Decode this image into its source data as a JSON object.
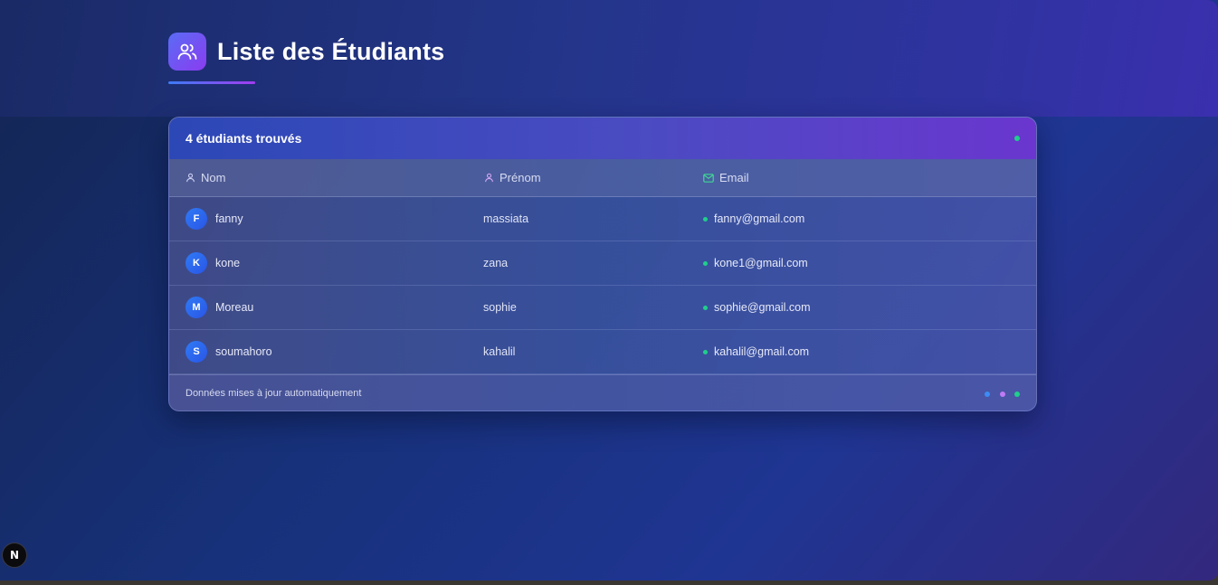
{
  "page": {
    "title": "Liste des Étudiants",
    "title_icon": "users-icon"
  },
  "table": {
    "count_label": "4 étudiants trouvés",
    "columns": [
      {
        "label": "Nom",
        "icon": "user-icon"
      },
      {
        "label": "Prénom",
        "icon": "user-icon"
      },
      {
        "label": "Email",
        "icon": "mail-icon"
      }
    ],
    "rows": [
      {
        "initial": "F",
        "nom": "fanny",
        "prenom": "massiata",
        "email": "fanny@gmail.com"
      },
      {
        "initial": "K",
        "nom": "kone",
        "prenom": "zana",
        "email": "kone1@gmail.com"
      },
      {
        "initial": "M",
        "nom": "Moreau",
        "prenom": "sophie",
        "email": "sophie@gmail.com"
      },
      {
        "initial": "S",
        "nom": "soumahoro",
        "prenom": "kahalil",
        "email": "kahalil@gmail.com"
      }
    ],
    "footer_note": "Données mises à jour automatiquement"
  },
  "dev_badge": {
    "label": "N"
  },
  "colors": {
    "accent_blue": "#3d7bf5",
    "accent_purple": "#a23cf0",
    "status_green": "#1fcf8a",
    "avatar_blue": "#2f7bf6"
  }
}
